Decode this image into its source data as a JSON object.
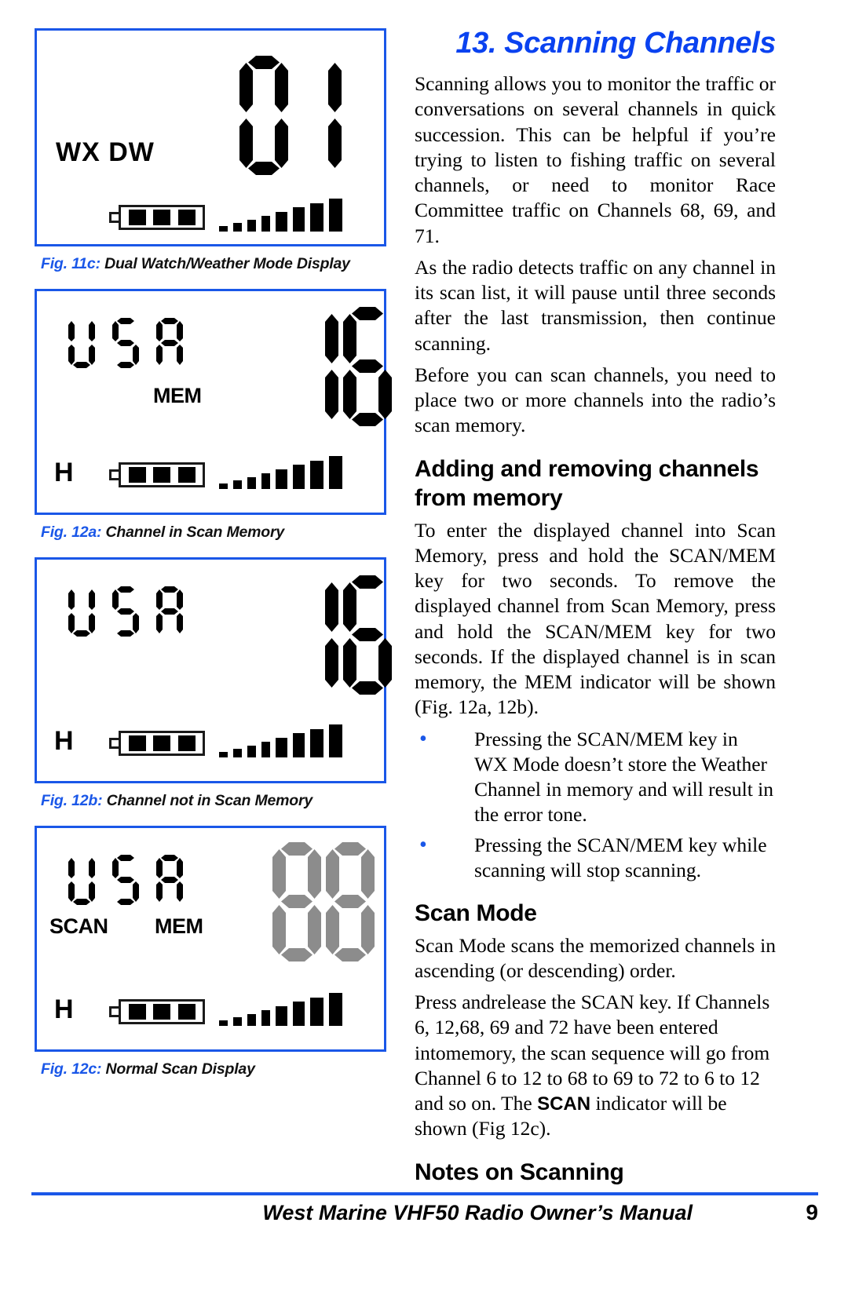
{
  "chapter": {
    "title": "13. Scanning Channels",
    "title_color": "#0a42f0"
  },
  "intro": {
    "p1": "Scanning allows you to monitor the traffic or conversations on several channels in quick succession. This can be helpful if you’re trying to listen to fishing traffic on several channels, or need to monitor Race Committee traffic on Channels 68, 69, and 71.",
    "p2": "As the radio detects traffic on any channel in its scan list, it will pause until three seconds after the last transmission, then continue scanning.",
    "p3": "Before you can scan channels, you need to place two or more channels into the radio’s scan memory."
  },
  "adding_section": {
    "heading": "Adding and removing channels from memory",
    "p1": "To enter the displayed channel into Scan Memory, press and hold the SCAN/MEM key for two seconds. To remove the displayed channel from Scan Memory, press and hold the SCAN/MEM key for two seconds. If the displayed channel is in scan memory, the MEM indicator will be shown (Fig. 12a, 12b).",
    "bullets": [
      "Pressing the SCAN/MEM key in WX Mode doesn’t store the Weather Channel in memory and will result in the error tone.",
      "Pressing the SCAN/MEM key while scanning will stop scanning."
    ],
    "bullet_color": "#1a57e8"
  },
  "scan_mode_section": {
    "heading": "Scan Mode",
    "p1": "Scan Mode scans the memorized channels in ascending (or descending) order.",
    "p2_part1": "Press andrelease the SCAN key. If Channels 6, 12,68, 69 and 72 have been entered intomemory, the scan sequence will go from Channel 6 to 12 to 68 to 69 to 72 to 6 to 12 and so on. The ",
    "p2_bold": "SCAN",
    "p2_part2": " indicator will be shown (Fig 12c)."
  },
  "notes_section": {
    "heading": "Notes on Scanning"
  },
  "figures": [
    {
      "id": "fig-11c",
      "caption_num": "Fig. 11c:",
      "caption_text": " Dual Watch/Weather Mode Display",
      "lcd": {
        "wx_dw": "WX DW",
        "channel": "01",
        "channel_color": "#000000",
        "battery_cells": 3,
        "signal_bars": 8
      }
    },
    {
      "id": "fig-12a",
      "caption_num": "Fig. 12a:",
      "caption_text": " Channel in Scan Memory",
      "lcd": {
        "mode": "USA",
        "annunciator": "MEM",
        "channel": "16",
        "channel_color": "#000000",
        "power": "H",
        "battery_cells": 3,
        "signal_bars": 8
      }
    },
    {
      "id": "fig-12b",
      "caption_num": "Fig. 12b:",
      "caption_text": " Channel not in Scan Memory",
      "lcd": {
        "mode": "USA",
        "annunciator": "",
        "channel": "16",
        "channel_color": "#000000",
        "power": "H",
        "battery_cells": 3,
        "signal_bars": 8
      }
    },
    {
      "id": "fig-12c",
      "caption_num": "Fig. 12c:",
      "caption_text": " Normal Scan Display",
      "lcd": {
        "mode": "USA",
        "annunciator_left": "SCAN",
        "annunciator": "MEM",
        "channel": "88",
        "channel_color": "#8c8c8c",
        "power": "H",
        "battery_cells": 3,
        "signal_bars": 8
      }
    }
  ],
  "footer": {
    "title": "West Marine VHF50 Radio Owner’s Manual",
    "page": "9",
    "rule_color": "#1a57e8"
  }
}
